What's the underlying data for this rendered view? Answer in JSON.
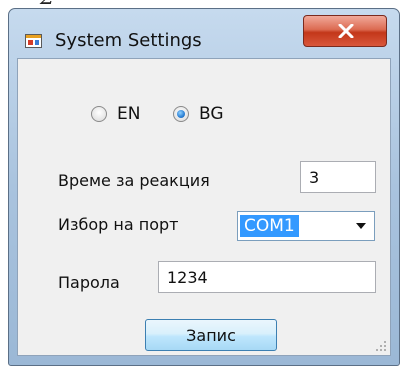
{
  "window": {
    "title": "System Settings",
    "cropped_top_text": "Σ                  ⁀"
  },
  "language": {
    "options": [
      {
        "label": "EN",
        "checked": false
      },
      {
        "label": "BG",
        "checked": true
      }
    ]
  },
  "form": {
    "reaction_label": "Време за реакция",
    "reaction_value": "3",
    "port_label": "Избор на порт",
    "port_value": "COM1",
    "password_label": "Парола",
    "password_value": "1234"
  },
  "buttons": {
    "save_label": "Запис"
  },
  "colors": {
    "selection": "#3399ff",
    "close_button": "#c3371a",
    "radio_checked": "#2a7fd4"
  },
  "icons": [
    "app-window-icon",
    "close-icon",
    "resize-grip-icon"
  ]
}
